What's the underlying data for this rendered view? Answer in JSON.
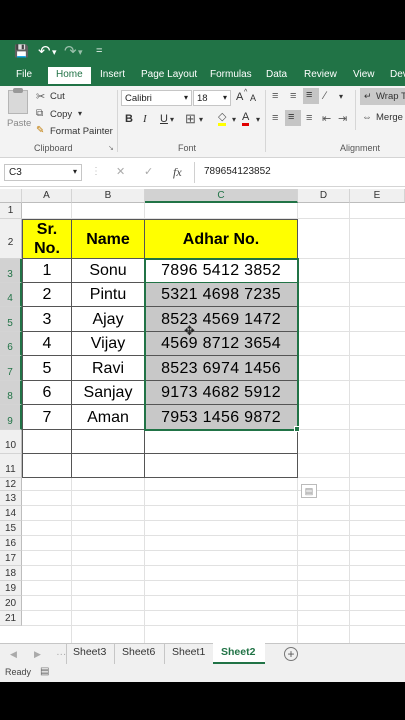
{
  "qat": {
    "save": "💾",
    "undo": "↶",
    "undo_drop": "▾",
    "redo": "↷",
    "redo_drop": "▾",
    "more": "="
  },
  "tabs": [
    "File",
    "Home",
    "Insert",
    "Page Layout",
    "Formulas",
    "Data",
    "Review",
    "View",
    "Dev"
  ],
  "ribbon": {
    "paste": "Paste",
    "cut": "Cut",
    "copy": "Copy",
    "format_painter": "Format Painter",
    "clipboard_label": "Clipboard",
    "font_name": "Calibri",
    "font_size": "18",
    "font_label": "Font",
    "bold": "B",
    "italic": "I",
    "underline": "U",
    "grow_font": "A",
    "shrink_font": "A",
    "font_color": "A",
    "wrap_text": "Wrap T",
    "merge": "Merge",
    "alignment_label": "Alignment"
  },
  "formula_bar": {
    "name_box": "C3",
    "fx": "fx",
    "cancel": "✕",
    "enter": "✓",
    "content": "789654123852"
  },
  "columns": [
    "A",
    "B",
    "C",
    "D",
    "E"
  ],
  "rows": [
    "1",
    "2",
    "3",
    "4",
    "5",
    "6",
    "7",
    "8",
    "9",
    "10",
    "11",
    "12",
    "13",
    "14",
    "15",
    "16",
    "17",
    "18",
    "19",
    "20",
    "21"
  ],
  "table": {
    "headers": {
      "sr": "Sr.\nNo.",
      "name": "Name",
      "adhar": "Adhar No."
    },
    "rows": [
      {
        "sr": "1",
        "name": "Sonu",
        "adhar": "7896 5412 3852"
      },
      {
        "sr": "2",
        "name": "Pintu",
        "adhar": "5321 4698 7235"
      },
      {
        "sr": "3",
        "name": "Ajay",
        "adhar": "8523 4569 1472"
      },
      {
        "sr": "4",
        "name": "Vijay",
        "adhar": "4569 8712 3654"
      },
      {
        "sr": "5",
        "name": "Ravi",
        "adhar": "8523 6974 1456"
      },
      {
        "sr": "6",
        "name": "Sanjay",
        "adhar": "9173 4682 5912"
      },
      {
        "sr": "7",
        "name": "Aman",
        "adhar": "7953 1456 9872"
      }
    ]
  },
  "sheets": {
    "tabs": [
      "Sheet3",
      "Sheet6",
      "Sheet1",
      "Sheet2"
    ],
    "active": "Sheet2",
    "add": "+"
  },
  "status": {
    "ready": "Ready"
  },
  "colors": {
    "excel_green": "#217346",
    "header_fill": "#ffff00",
    "selection_fill": "#c8c8c8"
  }
}
